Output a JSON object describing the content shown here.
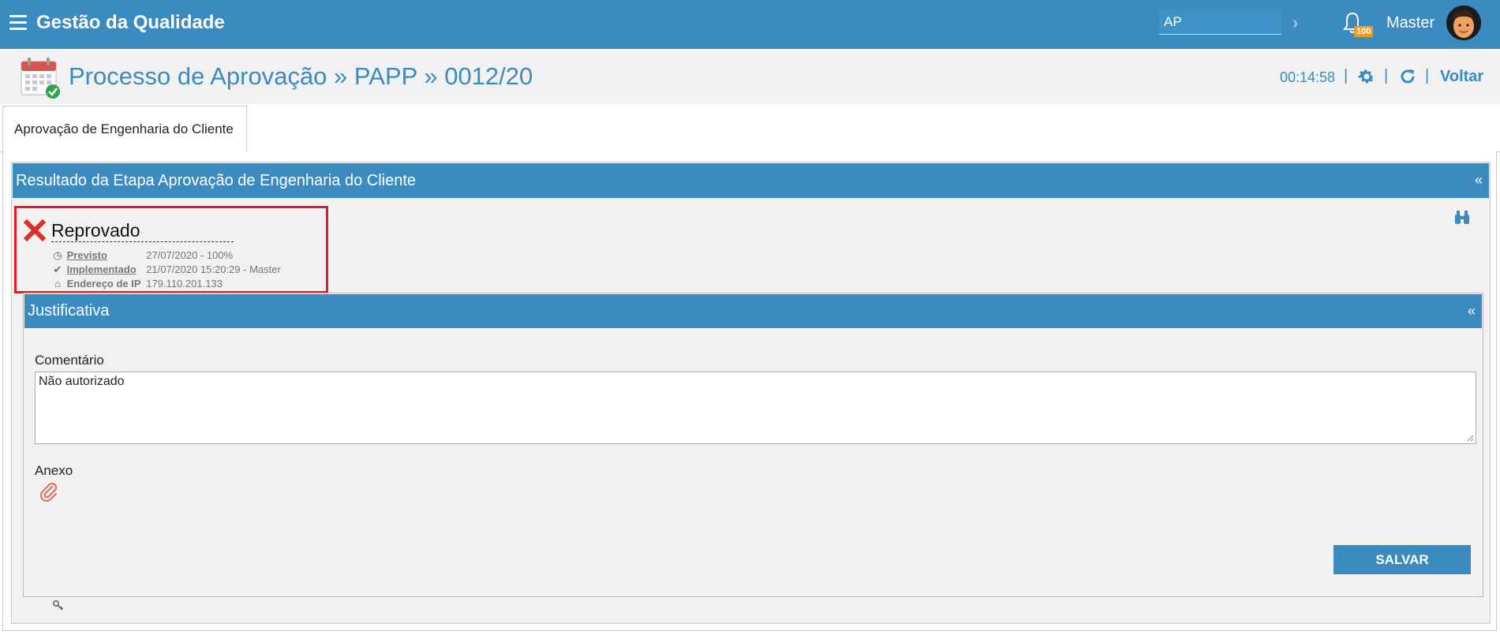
{
  "header": {
    "app_title": "Gestão da Qualidade",
    "search_value": "AP",
    "notification_count": "100",
    "user_name": "Master",
    "brand_color": "#3b8bc0"
  },
  "titlebar": {
    "title": "Processo de Aprovação » PAPP » 0012/20",
    "timer": "00:14:58",
    "back_label": "Voltar",
    "separator": "|"
  },
  "tabs": [
    {
      "label": "Aprovação de Engenharia do Cliente",
      "active": true
    }
  ],
  "result_section": {
    "title": "Resultado da Etapa Aprovação de Engenharia do Cliente",
    "collapse_symbol": "«",
    "status": "Reprovado",
    "meta": [
      {
        "icon": "clock-icon",
        "label": "Previsto",
        "value": "27/07/2020 - 100%"
      },
      {
        "icon": "check-icon",
        "label": "Implementado",
        "value": "21/07/2020 15:20:29 - Master"
      },
      {
        "icon": "bank-icon",
        "label": "Endereço de IP",
        "value": "179.110.201.133"
      }
    ],
    "highlight_color": "#e31b23"
  },
  "justification": {
    "title": "Justificativa",
    "collapse_symbol": "«",
    "comment_label": "Comentário",
    "comment_value": "Não autorizado",
    "attachment_label": "Anexo",
    "save_label": "SALVAR"
  }
}
